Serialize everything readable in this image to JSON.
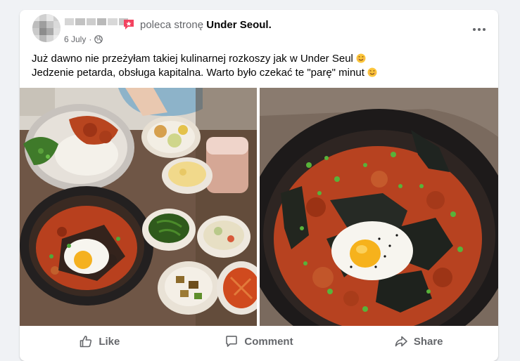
{
  "post": {
    "recommend_text": "poleca stronę",
    "page_name": "Under Seoul.",
    "date": "6 July",
    "body_line1": "Już dawno nie przeżyłam takiej kulinarnej rozkoszy jak w Under Seul",
    "body_line2": "Jedzenie petarda, obsługa kapitalna. Warto było czekać te \"parę\" minut",
    "photos": [
      "restaurant-table-photo",
      "bibimbap-closeup-photo"
    ]
  },
  "actions": {
    "like_label": "Like",
    "comment_label": "Comment",
    "share_label": "Share"
  },
  "icons": {
    "recommend": "recommend-icon",
    "privacy": "globe-icon",
    "more": "more-options-icon",
    "like": "thumbs-up-icon",
    "comment": "comment-bubble-icon",
    "share": "share-arrow-icon",
    "emoji": "smiling-face-icon"
  },
  "colors": {
    "card_background": "#ffffff",
    "page_background": "#f0f2f5",
    "secondary_text": "#65676b",
    "recommend_red": "#f3425f"
  }
}
